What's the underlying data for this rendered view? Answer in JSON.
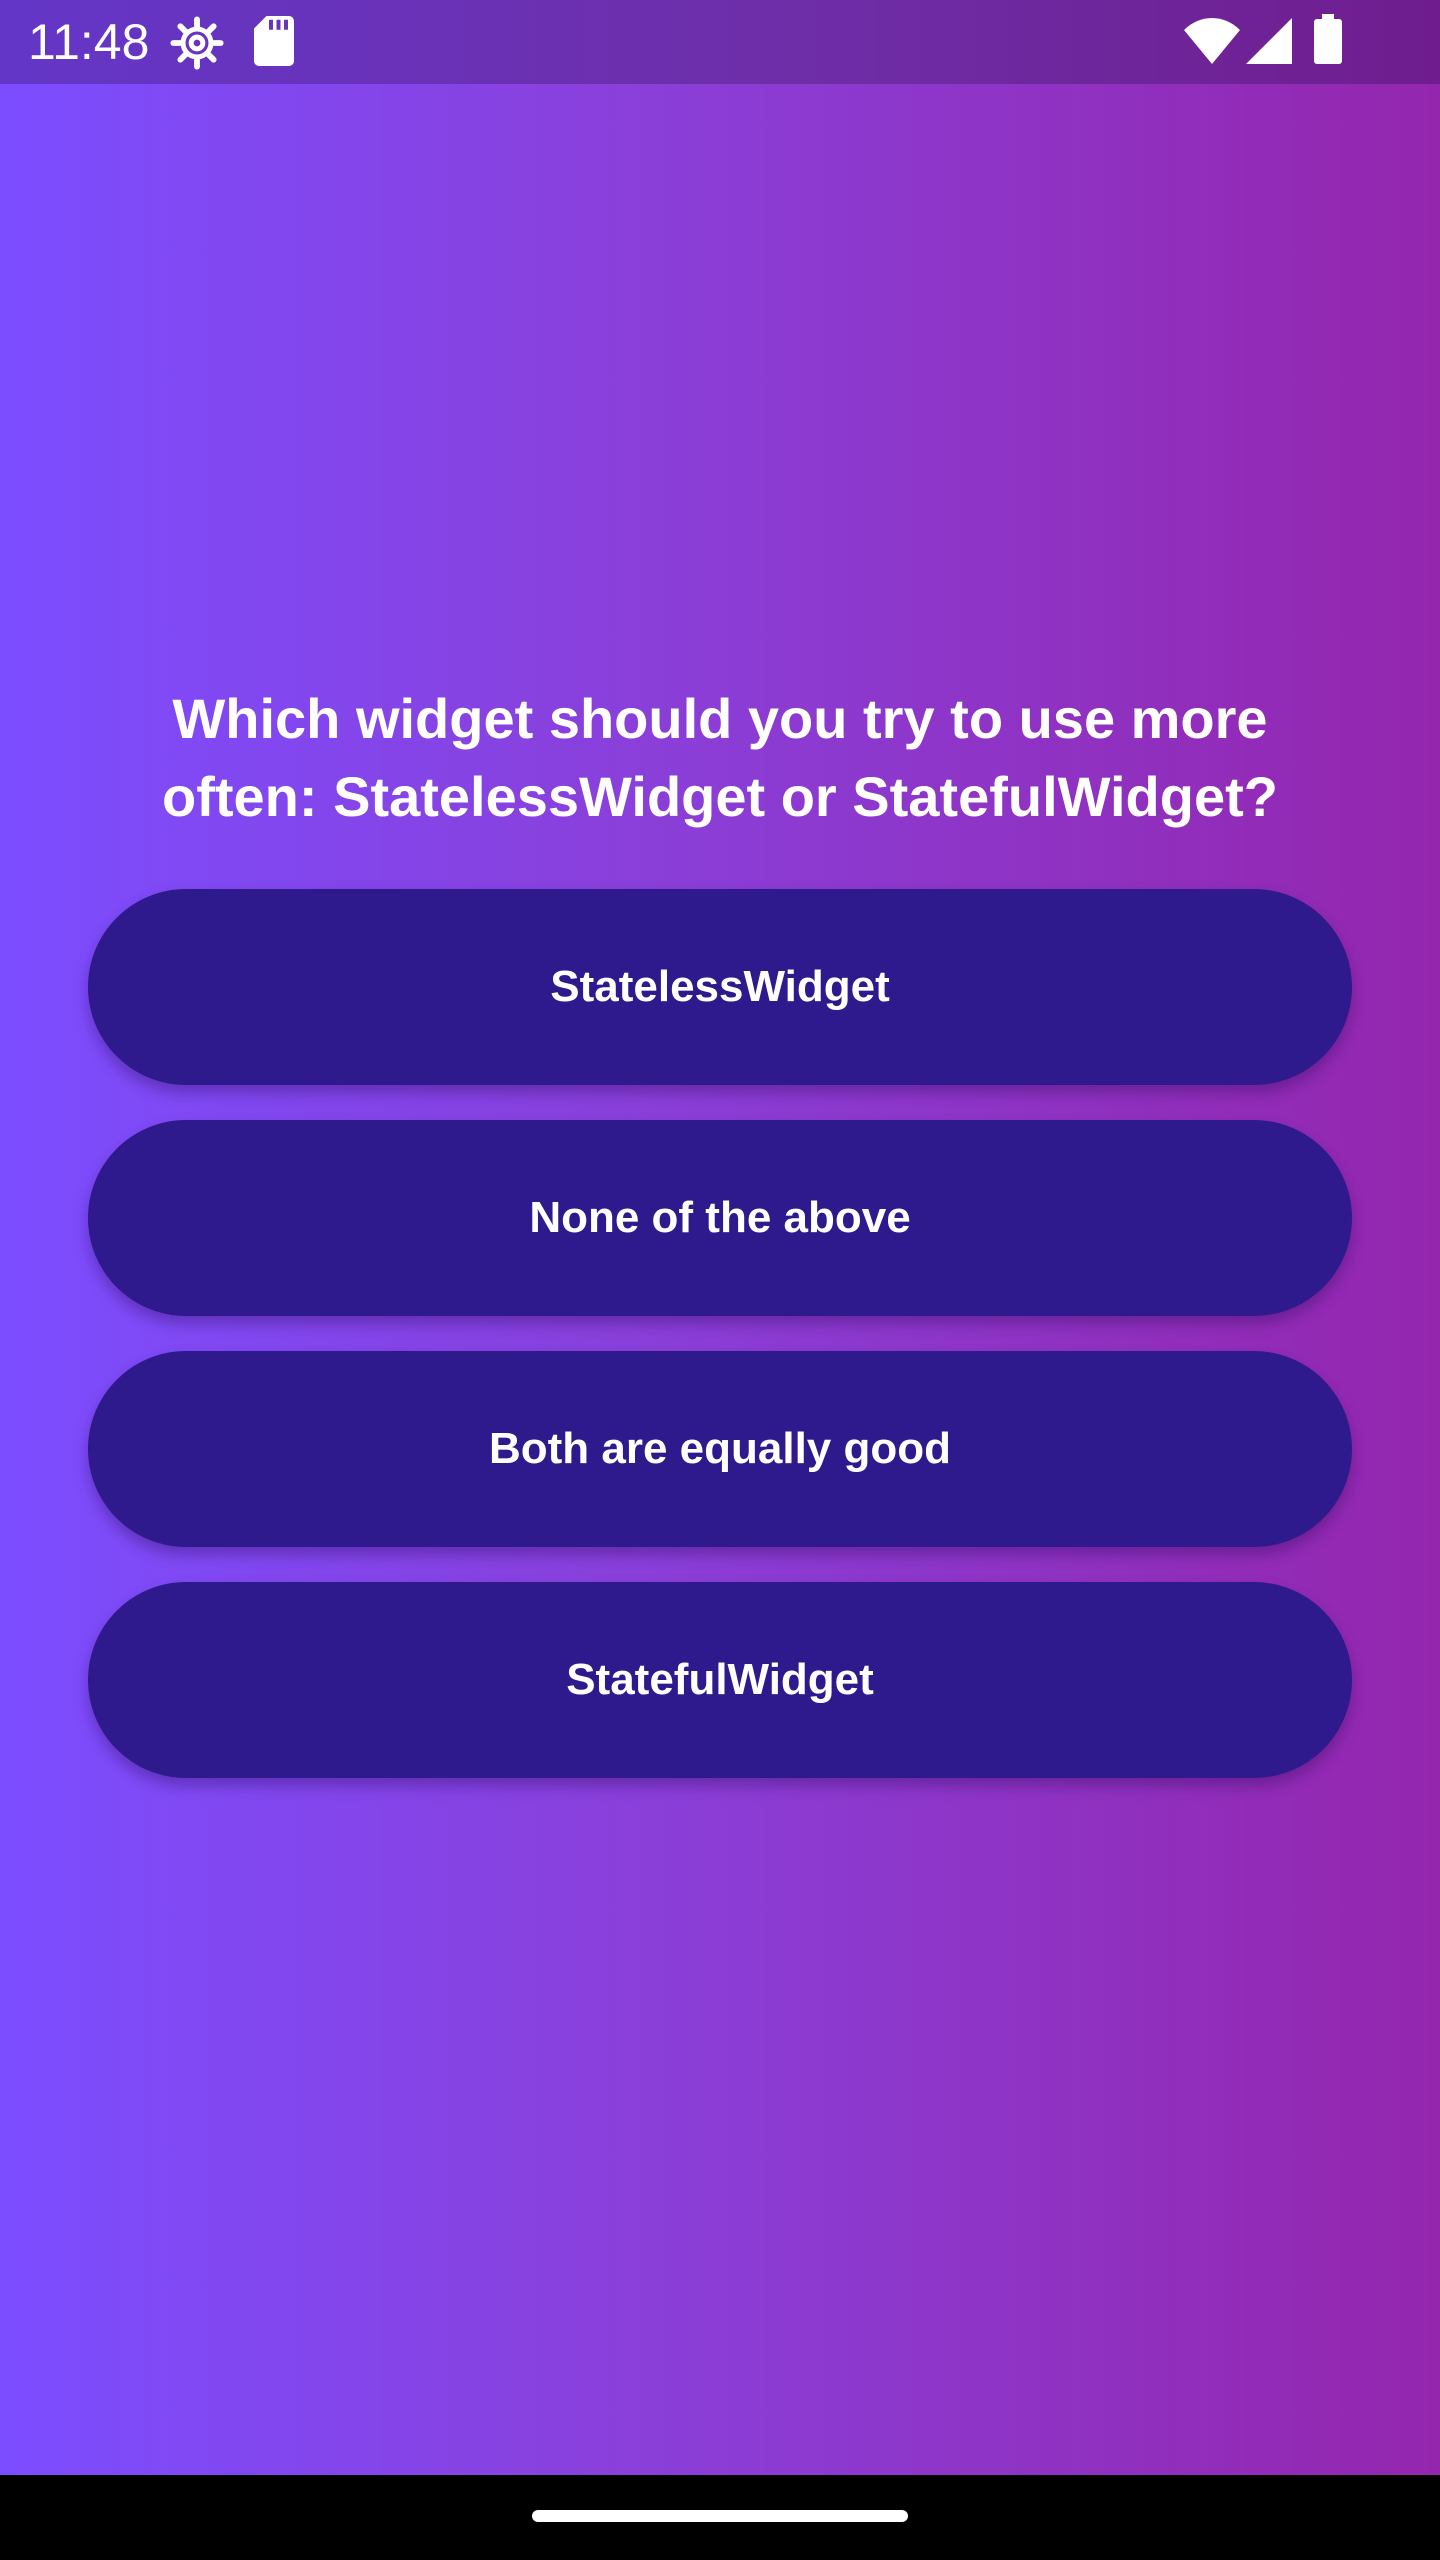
{
  "status_bar": {
    "time": "11:48",
    "icons": [
      "settings-gear-icon",
      "sd-card-icon",
      "wifi-icon",
      "cell-signal-icon",
      "battery-icon"
    ]
  },
  "quiz": {
    "question": "Which widget should you try to use more often: StatelessWidget or StatefulWidget?",
    "answers": [
      "StatelessWidget",
      "None of the above",
      "Both are equally good",
      "StatefulWidget"
    ]
  },
  "colors": {
    "gradient_start": "#7c4dff",
    "gradient_end": "#9426ae",
    "button_bg": "#2e1a8c",
    "text": "#ffffff"
  }
}
